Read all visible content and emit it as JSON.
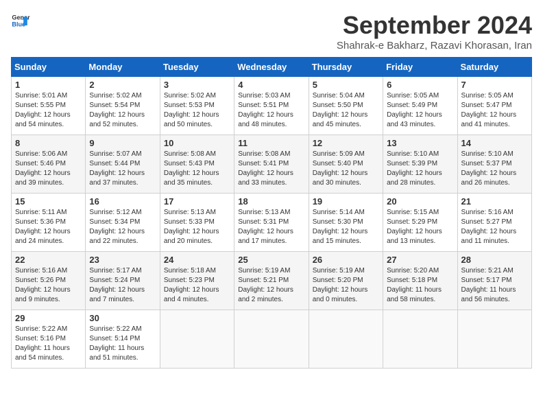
{
  "logo": {
    "line1": "General",
    "line2": "Blue"
  },
  "title": "September 2024",
  "subtitle": "Shahrak-e Bakharz, Razavi Khorasan, Iran",
  "weekdays": [
    "Sunday",
    "Monday",
    "Tuesday",
    "Wednesday",
    "Thursday",
    "Friday",
    "Saturday"
  ],
  "weeks": [
    [
      {
        "day": "1",
        "sunrise": "5:01 AM",
        "sunset": "5:55 PM",
        "daylight": "12 hours and 54 minutes."
      },
      {
        "day": "2",
        "sunrise": "5:02 AM",
        "sunset": "5:54 PM",
        "daylight": "12 hours and 52 minutes."
      },
      {
        "day": "3",
        "sunrise": "5:02 AM",
        "sunset": "5:53 PM",
        "daylight": "12 hours and 50 minutes."
      },
      {
        "day": "4",
        "sunrise": "5:03 AM",
        "sunset": "5:51 PM",
        "daylight": "12 hours and 48 minutes."
      },
      {
        "day": "5",
        "sunrise": "5:04 AM",
        "sunset": "5:50 PM",
        "daylight": "12 hours and 45 minutes."
      },
      {
        "day": "6",
        "sunrise": "5:05 AM",
        "sunset": "5:49 PM",
        "daylight": "12 hours and 43 minutes."
      },
      {
        "day": "7",
        "sunrise": "5:05 AM",
        "sunset": "5:47 PM",
        "daylight": "12 hours and 41 minutes."
      }
    ],
    [
      {
        "day": "8",
        "sunrise": "5:06 AM",
        "sunset": "5:46 PM",
        "daylight": "12 hours and 39 minutes."
      },
      {
        "day": "9",
        "sunrise": "5:07 AM",
        "sunset": "5:44 PM",
        "daylight": "12 hours and 37 minutes."
      },
      {
        "day": "10",
        "sunrise": "5:08 AM",
        "sunset": "5:43 PM",
        "daylight": "12 hours and 35 minutes."
      },
      {
        "day": "11",
        "sunrise": "5:08 AM",
        "sunset": "5:41 PM",
        "daylight": "12 hours and 33 minutes."
      },
      {
        "day": "12",
        "sunrise": "5:09 AM",
        "sunset": "5:40 PM",
        "daylight": "12 hours and 30 minutes."
      },
      {
        "day": "13",
        "sunrise": "5:10 AM",
        "sunset": "5:39 PM",
        "daylight": "12 hours and 28 minutes."
      },
      {
        "day": "14",
        "sunrise": "5:10 AM",
        "sunset": "5:37 PM",
        "daylight": "12 hours and 26 minutes."
      }
    ],
    [
      {
        "day": "15",
        "sunrise": "5:11 AM",
        "sunset": "5:36 PM",
        "daylight": "12 hours and 24 minutes."
      },
      {
        "day": "16",
        "sunrise": "5:12 AM",
        "sunset": "5:34 PM",
        "daylight": "12 hours and 22 minutes."
      },
      {
        "day": "17",
        "sunrise": "5:13 AM",
        "sunset": "5:33 PM",
        "daylight": "12 hours and 20 minutes."
      },
      {
        "day": "18",
        "sunrise": "5:13 AM",
        "sunset": "5:31 PM",
        "daylight": "12 hours and 17 minutes."
      },
      {
        "day": "19",
        "sunrise": "5:14 AM",
        "sunset": "5:30 PM",
        "daylight": "12 hours and 15 minutes."
      },
      {
        "day": "20",
        "sunrise": "5:15 AM",
        "sunset": "5:29 PM",
        "daylight": "12 hours and 13 minutes."
      },
      {
        "day": "21",
        "sunrise": "5:16 AM",
        "sunset": "5:27 PM",
        "daylight": "12 hours and 11 minutes."
      }
    ],
    [
      {
        "day": "22",
        "sunrise": "5:16 AM",
        "sunset": "5:26 PM",
        "daylight": "12 hours and 9 minutes."
      },
      {
        "day": "23",
        "sunrise": "5:17 AM",
        "sunset": "5:24 PM",
        "daylight": "12 hours and 7 minutes."
      },
      {
        "day": "24",
        "sunrise": "5:18 AM",
        "sunset": "5:23 PM",
        "daylight": "12 hours and 4 minutes."
      },
      {
        "day": "25",
        "sunrise": "5:19 AM",
        "sunset": "5:21 PM",
        "daylight": "12 hours and 2 minutes."
      },
      {
        "day": "26",
        "sunrise": "5:19 AM",
        "sunset": "5:20 PM",
        "daylight": "12 hours and 0 minutes."
      },
      {
        "day": "27",
        "sunrise": "5:20 AM",
        "sunset": "5:18 PM",
        "daylight": "11 hours and 58 minutes."
      },
      {
        "day": "28",
        "sunrise": "5:21 AM",
        "sunset": "5:17 PM",
        "daylight": "11 hours and 56 minutes."
      }
    ],
    [
      {
        "day": "29",
        "sunrise": "5:22 AM",
        "sunset": "5:16 PM",
        "daylight": "11 hours and 54 minutes."
      },
      {
        "day": "30",
        "sunrise": "5:22 AM",
        "sunset": "5:14 PM",
        "daylight": "11 hours and 51 minutes."
      },
      null,
      null,
      null,
      null,
      null
    ]
  ]
}
